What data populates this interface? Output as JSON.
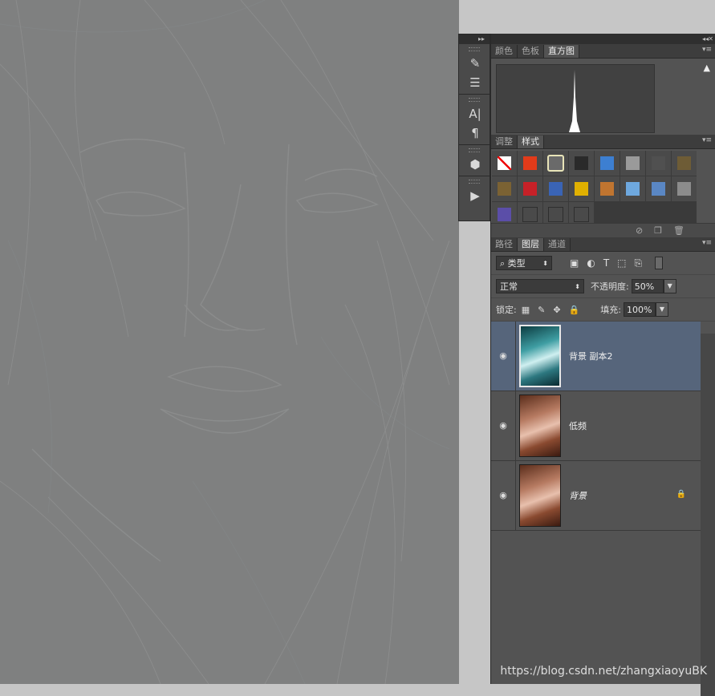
{
  "app": {
    "canvas_image": "high-pass filtered portrait of a woman's face, gray",
    "tool_strip_icons": [
      "brush-presets-icon",
      "brush-settings-icon",
      "character-icon",
      "paragraph-icon",
      "3d-icon",
      "actions-icon"
    ]
  },
  "panel_color": {
    "tabs": [
      "颜色",
      "色板",
      "直方图"
    ],
    "active_tab": "直方图",
    "warning_symbol": "▲"
  },
  "panel_styles": {
    "tabs": [
      "调整",
      "样式"
    ],
    "active_tab": "样式",
    "swatch_colors": [
      "none",
      "#e23b1a",
      "#6a6a6a",
      "#2a2a2a",
      "#3d7fd1",
      "#9a9a9a",
      "#505050",
      "#6e5c36",
      "#7b6233",
      "#c62128",
      "#3a64b5",
      "#e0b000",
      "#c07530",
      "#6ea8de",
      "#5a87c4",
      "#8c8c8c",
      "#5b4ea8",
      "#4a4a4a",
      "#4a4a4a",
      "#4a4a4a"
    ]
  },
  "panel_layers": {
    "tabs": [
      "路径",
      "图层",
      "通道"
    ],
    "active_tab": "图层",
    "filter_kind": "类型",
    "blend_mode": "正常",
    "opacity_label": "不透明度:",
    "opacity_value": "50%",
    "lock_label": "锁定:",
    "fill_label": "填充:",
    "fill_value": "100%",
    "layers": [
      {
        "name": "背景 副本2",
        "selected": true,
        "locked": false,
        "italic": false
      },
      {
        "name": "低频",
        "selected": false,
        "locked": false,
        "italic": false
      },
      {
        "name": "背景",
        "selected": false,
        "locked": true,
        "italic": true
      }
    ]
  },
  "watermark": "https://blog.csdn.net/zhangxiaoyuBK"
}
